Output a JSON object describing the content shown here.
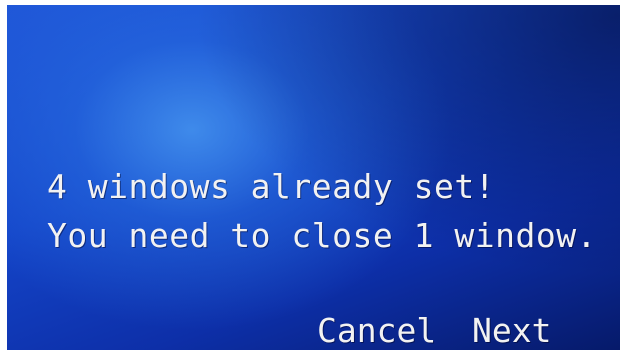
{
  "dialog": {
    "message_line1": "4 windows already set!",
    "message_line2": "You need to close 1 window.",
    "cancel_label": "Cancel",
    "next_label": "Next"
  },
  "colors": {
    "background_primary": "#1445c9",
    "background_highlight": "#4696f0",
    "text": "#f2f2f2"
  }
}
